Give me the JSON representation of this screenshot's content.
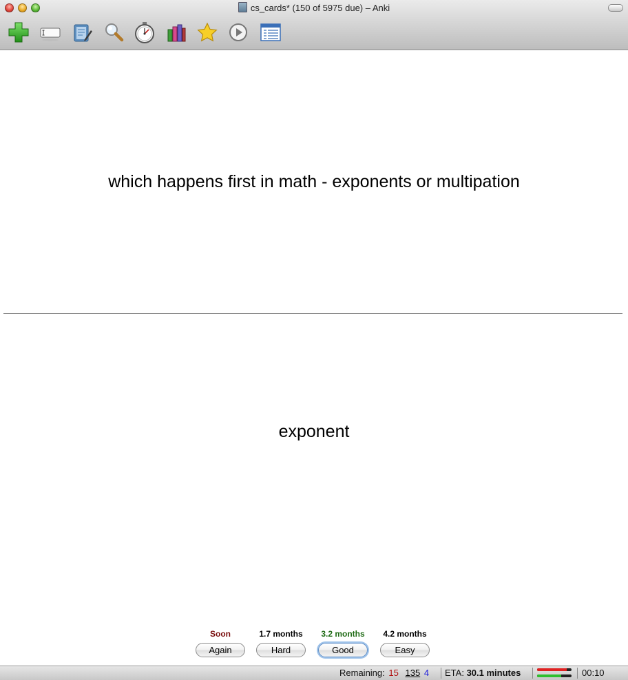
{
  "window": {
    "title": "cs_cards* (150 of 5975 due) – Anki"
  },
  "toolbar": {
    "items": [
      {
        "name": "add-icon",
        "label": "Add"
      },
      {
        "name": "edit-field-icon",
        "label": "Edit"
      },
      {
        "name": "notepad-icon",
        "label": "Notes"
      },
      {
        "name": "magnifier-icon",
        "label": "Browse"
      },
      {
        "name": "stopwatch-icon",
        "label": "Timer"
      },
      {
        "name": "stats-bars-icon",
        "label": "Statistics"
      },
      {
        "name": "star-icon",
        "label": "Mark"
      },
      {
        "name": "play-icon",
        "label": "Replay"
      },
      {
        "name": "list-window-icon",
        "label": "Card Info"
      }
    ]
  },
  "card": {
    "question": "which happens first in math - exponents or multipation",
    "answer": "exponent"
  },
  "ease_buttons": [
    {
      "interval": "Soon",
      "label": "Again",
      "color": "#7a0e0e"
    },
    {
      "interval": "1.7 months",
      "label": "Hard",
      "color": "#000000"
    },
    {
      "interval": "3.2 months",
      "label": "Good",
      "color": "#1f6b15"
    },
    {
      "interval": "4.2 months",
      "label": "Easy",
      "color": "#000000"
    }
  ],
  "status": {
    "remaining_label": "Remaining:",
    "new_count": "15",
    "review_count": "135",
    "learn_count": "4",
    "eta_label": "ETA:",
    "eta_value": "30.1 minutes",
    "progress_red": 0.85,
    "progress_green": 0.7,
    "timer": "00:10",
    "colors": {
      "new": "#b01010",
      "review": "#000000",
      "learn": "#1a1adb"
    }
  }
}
